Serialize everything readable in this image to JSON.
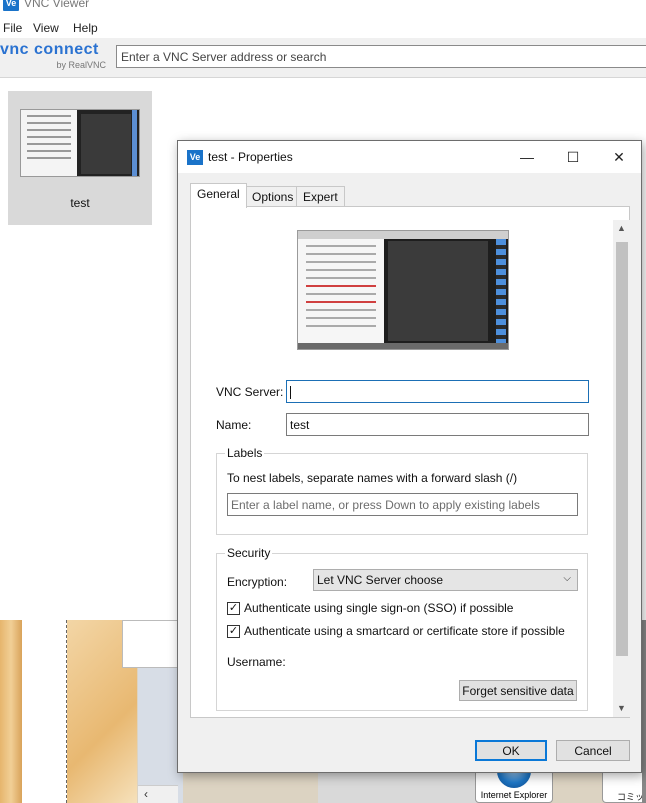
{
  "app": {
    "icon_text": "Ve",
    "title": "VNC Viewer"
  },
  "menu": [
    "File",
    "View",
    "Help"
  ],
  "logo": {
    "main": "vnc connect",
    "sub": "by RealVNC"
  },
  "search": {
    "placeholder": "Enter a VNC Server address or search"
  },
  "connections": [
    {
      "label": "test"
    }
  ],
  "desktop": {
    "ie_label": "Internet Explorer",
    "comic_label": "コミック",
    "scroll_left": "‹"
  },
  "dialog": {
    "icon_text": "Ve",
    "title": "test - Properties",
    "controls": {
      "minimize": "—",
      "maximize": "☐",
      "close": "✕"
    },
    "tabs": [
      "General",
      "Options",
      "Expert"
    ],
    "active_tab": "General",
    "fields": {
      "vnc_server_label": "VNC Server:",
      "vnc_server_value": "",
      "name_label": "Name:",
      "name_value": "test"
    },
    "labels_group": {
      "title": "Labels",
      "hint": "To nest labels, separate names with a forward slash (/)",
      "placeholder": "Enter a label name, or press Down to apply existing labels"
    },
    "security_group": {
      "title": "Security",
      "encryption_label": "Encryption:",
      "encryption_value": "Let VNC Server choose",
      "sso_label": "Authenticate using single sign-on (SSO) if possible",
      "sso_checked": true,
      "smartcard_label": "Authenticate using a smartcard or certificate store if possible",
      "smartcard_checked": true,
      "username_label": "Username:",
      "forget_button": "Forget sensitive data"
    },
    "buttons": {
      "ok": "OK",
      "cancel": "Cancel"
    }
  },
  "colors": {
    "accent": "#0a78d7",
    "brand": "#2a72d1",
    "tile_bg": "#d9d9d9"
  }
}
